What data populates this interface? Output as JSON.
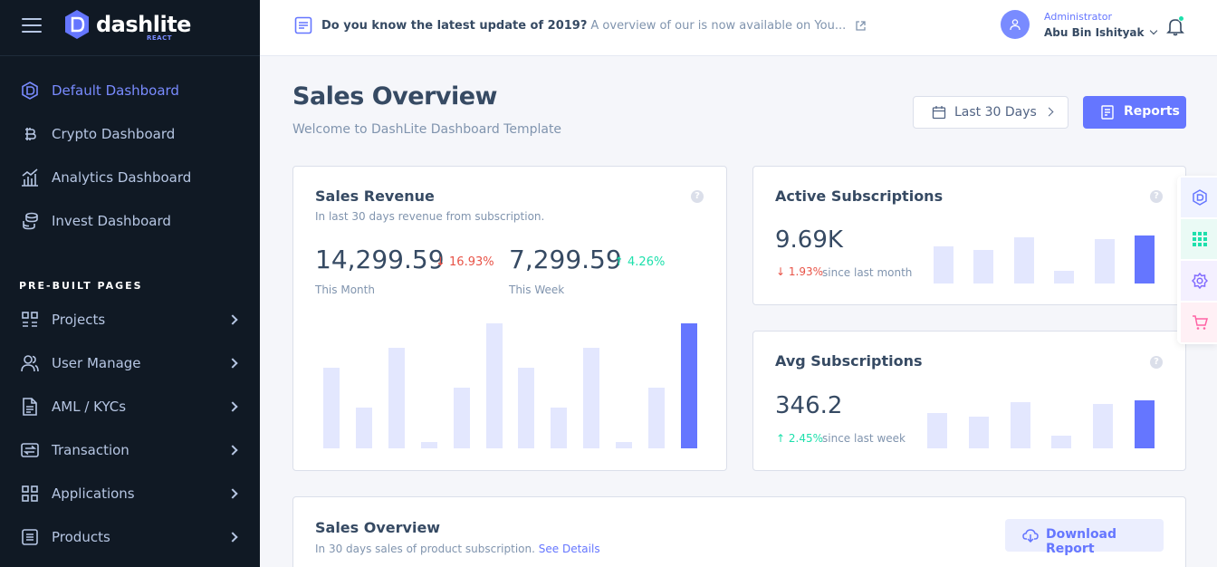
{
  "brand": {
    "name": "dashlite",
    "sub": "REACT"
  },
  "sidebar": {
    "dashboards": [
      {
        "label": "Default Dashboard",
        "active": true,
        "icon": "dashlite-icon"
      },
      {
        "label": "Crypto Dashboard",
        "active": false,
        "icon": "bitcoin-icon"
      },
      {
        "label": "Analytics Dashboard",
        "active": false,
        "icon": "chart-icon"
      },
      {
        "label": "Invest Dashboard",
        "active": false,
        "icon": "coins-icon"
      }
    ],
    "heading": "PRE-BUILT PAGES",
    "pages": [
      {
        "label": "Projects",
        "icon": "projects-icon"
      },
      {
        "label": "User Manage",
        "icon": "users-icon"
      },
      {
        "label": "AML / KYCs",
        "icon": "file-icon"
      },
      {
        "label": "Transaction",
        "icon": "transfer-icon"
      },
      {
        "label": "Applications",
        "icon": "grid-icon"
      },
      {
        "label": "Products",
        "icon": "list-icon"
      }
    ]
  },
  "topbar": {
    "news_bold": "Do you know the latest update of 2019?",
    "news_rest": "A overview of our is now available on You...",
    "user_role": "Administrator",
    "user_name": "Abu Bin Ishityak"
  },
  "header": {
    "title": "Sales Overview",
    "subtitle": "Welcome to DashLite Dashboard Template",
    "range_label": "Last 30 Days",
    "reports_label": "Reports"
  },
  "sales_revenue": {
    "title": "Sales Revenue",
    "subtitle": "In last 30 days revenue from subscription.",
    "month_value": "14,299.59",
    "month_change": "16.93%",
    "month_label": "This Month",
    "week_value": "7,299.59",
    "week_change": "4.26%",
    "week_label": "This Week"
  },
  "active_subs": {
    "title": "Active Subscriptions",
    "value": "9.69K",
    "change": "1.93%",
    "since": "since last month"
  },
  "avg_subs": {
    "title": "Avg Subscriptions",
    "value": "346.2",
    "change": "2.45%",
    "since": "since last week"
  },
  "sales_overview": {
    "title": "Sales Overview",
    "subtitle": "In 30 days sales of product subscription.",
    "link": "See Details",
    "download_label": "Download Report"
  },
  "colors": {
    "accent": "#6576ff",
    "sidebar": "#101924",
    "bar_light": "#e3e7fe",
    "up": "#1ee0ac",
    "down": "#e85347"
  },
  "chart_data": [
    {
      "type": "bar",
      "name": "sales-revenue",
      "values": [
        8,
        4,
        10,
        0.6,
        6,
        12.4,
        8,
        4,
        10,
        0.6,
        6,
        12.4
      ],
      "highlight_last": true,
      "ylim": [
        0,
        12.4
      ]
    },
    {
      "type": "bar",
      "name": "active-subscriptions",
      "values": [
        10,
        9,
        12.5,
        3.5,
        12,
        13
      ],
      "highlight_last": true,
      "ylim": [
        0,
        13
      ]
    },
    {
      "type": "bar",
      "name": "avg-subscriptions",
      "values": [
        10,
        9,
        13,
        3.5,
        12.5,
        13.5
      ],
      "highlight_last": true,
      "ylim": [
        0,
        13.5
      ]
    }
  ]
}
